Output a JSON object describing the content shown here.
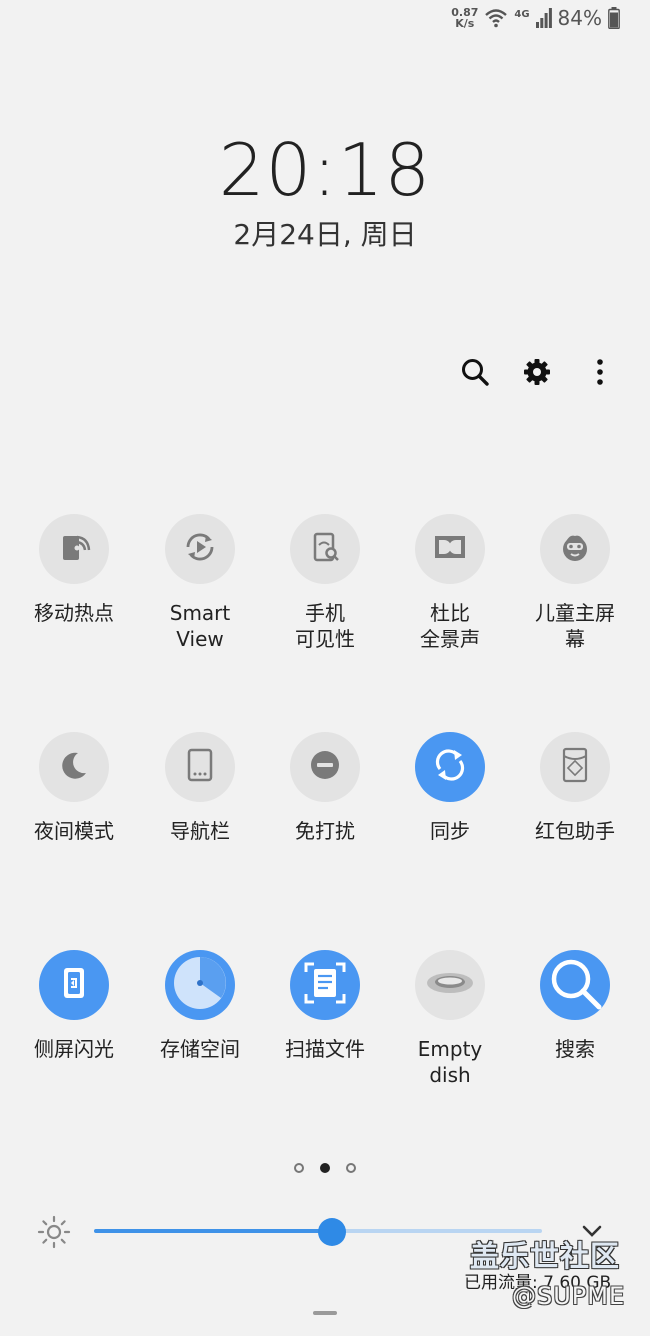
{
  "status_bar": {
    "net_speed_value": "0.87",
    "net_speed_unit": "K/s",
    "wifi_icon": "wifi-icon",
    "network_type": "4G",
    "signal_icon": "signal-icon",
    "battery_percent": "84%",
    "battery_icon": "battery-icon"
  },
  "lock": {
    "time": "20:18",
    "date": "2月24日, 周日"
  },
  "toolbar": {
    "icons": [
      "search-icon",
      "gear-icon",
      "more-vertical-icon"
    ]
  },
  "tiles": [
    {
      "id": "hotspot",
      "line1": "移动热点",
      "line2": "",
      "active": false,
      "icon": "hotspot-icon"
    },
    {
      "id": "smart-view",
      "line1": "Smart",
      "line2": "View",
      "active": false,
      "icon": "smart-view-icon"
    },
    {
      "id": "visibility",
      "line1": "手机",
      "line2": "可见性",
      "active": false,
      "icon": "phone-visibility-icon"
    },
    {
      "id": "dolby",
      "line1": "杜比",
      "line2": "全景声",
      "active": false,
      "icon": "dolby-icon"
    },
    {
      "id": "kids-home",
      "line1": "儿童主屏",
      "line2": "幕",
      "active": false,
      "icon": "kids-face-icon"
    },
    {
      "id": "night-mode",
      "line1": "夜间模式",
      "line2": "",
      "active": false,
      "icon": "moon-icon"
    },
    {
      "id": "nav-bar",
      "line1": "导航栏",
      "line2": "",
      "active": false,
      "icon": "nav-bar-icon"
    },
    {
      "id": "dnd",
      "line1": "免打扰",
      "line2": "",
      "active": false,
      "icon": "do-not-disturb-icon"
    },
    {
      "id": "sync",
      "line1": "同步",
      "line2": "",
      "active": true,
      "icon": "sync-icon"
    },
    {
      "id": "red-envelope",
      "line1": "红包助手",
      "line2": "",
      "active": false,
      "icon": "red-envelope-icon"
    },
    {
      "id": "edge-lighting",
      "line1": "侧屏闪光",
      "line2": "",
      "active": true,
      "icon": "edge-lighting-icon"
    },
    {
      "id": "storage",
      "line1": "存储空间",
      "line2": "",
      "active": true,
      "icon": "storage-icon"
    },
    {
      "id": "scan-doc",
      "line1": "扫描文件",
      "line2": "",
      "active": true,
      "icon": "scan-document-icon"
    },
    {
      "id": "empty-dish",
      "line1": "Empty",
      "line2": "dish",
      "active": false,
      "icon": "dish-icon"
    },
    {
      "id": "search-tile",
      "line1": "搜索",
      "line2": "",
      "active": true,
      "icon": "search-icon"
    }
  ],
  "pager": {
    "pages": 3,
    "current": 2
  },
  "brightness": {
    "level": 0.53,
    "sun_icon": "brightness-icon",
    "expand_icon": "chevron-down-icon"
  },
  "watermark": {
    "title": "盖乐世社区",
    "usage": "已用流量: 7.60 GB",
    "handle": "@SUPME"
  },
  "colors": {
    "background": "#f2f2f2",
    "accent": "#4a97f2",
    "tile_off": "#e3e3e3"
  }
}
